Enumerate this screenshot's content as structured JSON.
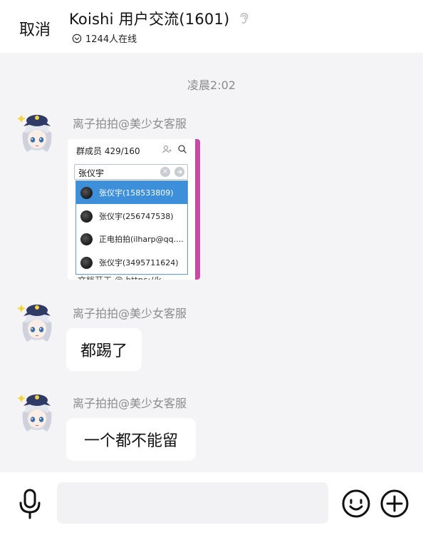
{
  "header": {
    "cancel_label": "取消",
    "title": "Koishi 用户交流(1601)",
    "online_text": "1244人在线"
  },
  "chat": {
    "timestamp": "凌晨2:02",
    "messages": [
      {
        "sender": "离子拍拍@美少女客服",
        "type": "image",
        "image": {
          "header_text": "群成员 429/160",
          "search_text": "张仪宇",
          "results": [
            "张仪宇(158533809)",
            "张仪宇(256747538)",
            "正电拍拍(ilharp@qq....",
            "张仪宇(3495711624)"
          ],
          "bottom_text": "文档开工 @ https://k"
        }
      },
      {
        "sender": "离子拍拍@美少女客服",
        "type": "text",
        "text": "都踢了"
      },
      {
        "sender": "离子拍拍@美少女客服",
        "type": "text",
        "text": "一个都不能留"
      }
    ]
  },
  "input": {
    "value": "",
    "placeholder": ""
  },
  "icons": {
    "ear": "ear-icon",
    "online": "chevron-down-circle-icon",
    "mic": "microphone-icon",
    "emoji": "smiley-icon",
    "plus": "plus-circle-icon"
  }
}
